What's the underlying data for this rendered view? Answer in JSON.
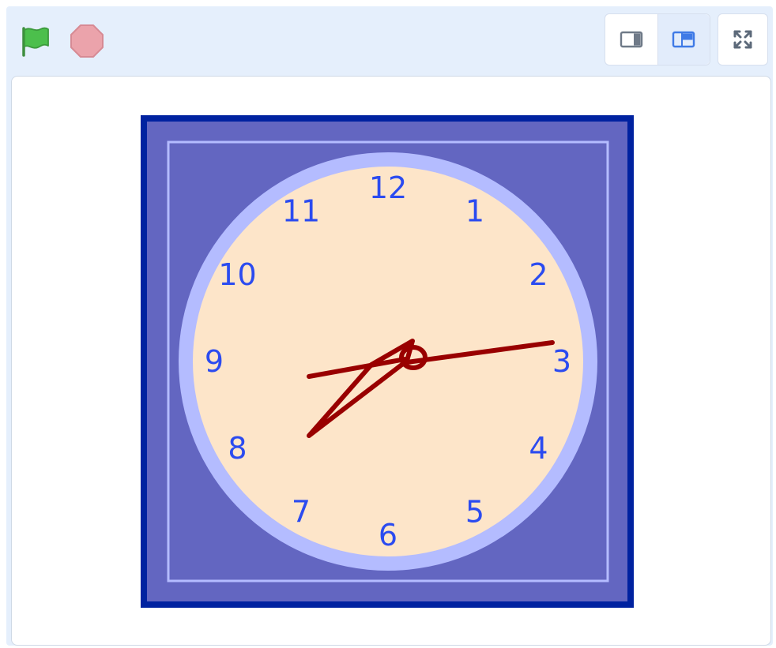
{
  "toolbar": {
    "green_flag_icon": "green-flag-icon",
    "stop_icon": "stop-sign-icon",
    "small_stage_icon": "small-stage-icon",
    "normal_stage_icon": "normal-stage-icon",
    "fullscreen_icon": "fullscreen-icon"
  },
  "clock": {
    "numbers": [
      "12",
      "1",
      "2",
      "3",
      "4",
      "5",
      "6",
      "7",
      "8",
      "9",
      "10",
      "11"
    ],
    "colors": {
      "frame_outer": "#0022a0",
      "frame_inner": "#6366c1",
      "rim": "#b4bcff",
      "face": "#fde5c9",
      "numerals": "#2b4bf0",
      "hands": "#990000"
    }
  }
}
